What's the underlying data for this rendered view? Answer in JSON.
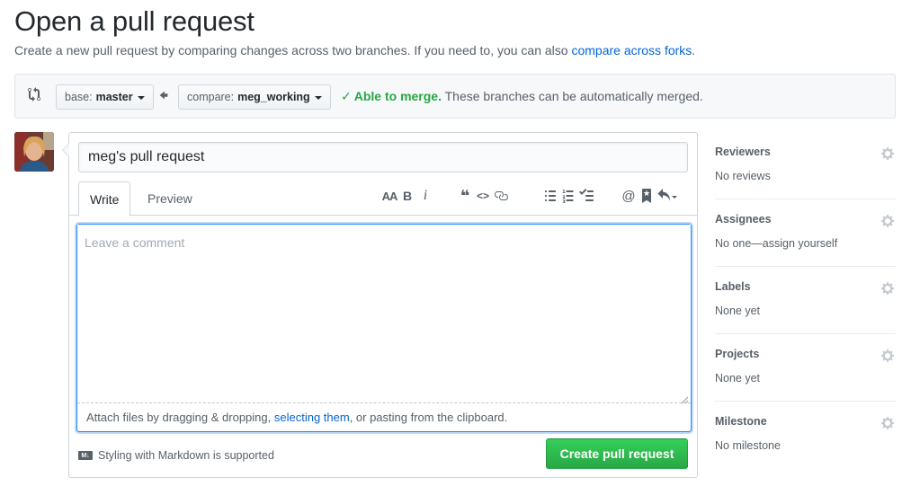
{
  "header": {
    "title": "Open a pull request",
    "subtitle": "Create a new pull request by comparing changes across two branches. If you need to, you can also ",
    "subtitle_link": "compare across forks",
    "subtitle_end": "."
  },
  "range": {
    "base_key": "base:",
    "base_value": "master",
    "compare_key": "compare:",
    "compare_value": "meg_working",
    "merge_ok": "Able to merge.",
    "merge_text": " These branches can be automatically merged."
  },
  "form": {
    "title_value": "meg's pull request",
    "tabs": [
      "Write",
      "Preview"
    ],
    "comment_placeholder": "Leave a comment",
    "attach_start": "Attach files by dragging & dropping, ",
    "attach_link": "selecting them",
    "attach_end": ", or pasting from the clipboard.",
    "markdown_note": "Styling with Markdown is supported",
    "markdown_badge": "M↓",
    "submit_label": "Create pull request",
    "toolbar_text": {
      "header": "AA",
      "bold": "B",
      "italic": "i",
      "quote": "❝",
      "code": "<>",
      "mention": "@"
    }
  },
  "sidebar": {
    "items": [
      {
        "heading": "Reviewers",
        "value": "No reviews"
      },
      {
        "heading": "Assignees",
        "value": "No one—assign yourself"
      },
      {
        "heading": "Labels",
        "value": "None yet"
      },
      {
        "heading": "Projects",
        "value": "None yet"
      },
      {
        "heading": "Milestone",
        "value": "No milestone"
      }
    ]
  },
  "colors": {
    "link": "#0366d6",
    "success": "#28a745",
    "button_green": "#2ea44f",
    "focus": "#2188ff"
  }
}
